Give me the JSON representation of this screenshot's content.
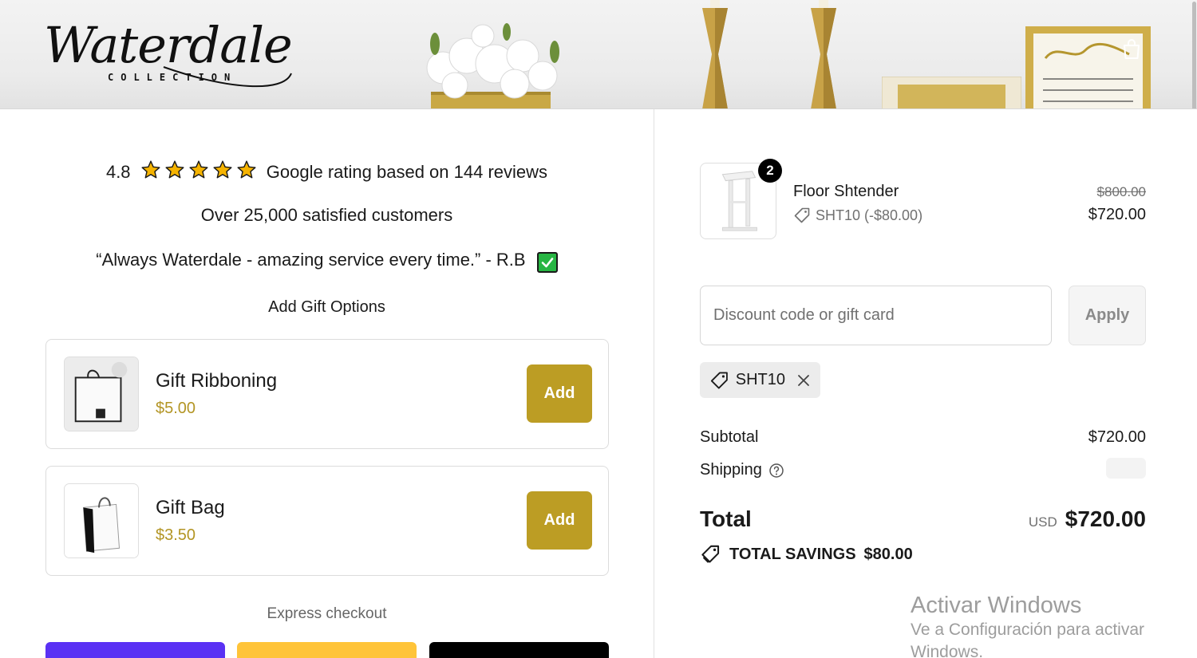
{
  "banner": {
    "logo_text": "Waterdale",
    "logo_subtitle": "COLLECTION"
  },
  "trust": {
    "rating_value": "4.8",
    "rating_text": "Google rating based on 144 reviews",
    "customers_text": "Over 25,000 satisfied customers",
    "quote_text": "“Always Waterdale - amazing service every time.” - R.B"
  },
  "gift_options": {
    "heading": "Add Gift Options",
    "items": [
      {
        "title": "Gift Ribboning",
        "price": "$5.00",
        "button": "Add"
      },
      {
        "title": "Gift Bag",
        "price": "$3.50",
        "button": "Add"
      }
    ]
  },
  "express": {
    "label": "Express checkout",
    "colors": [
      "#5a31f4",
      "#ffc439",
      "#000000"
    ]
  },
  "order": {
    "product": {
      "quantity": "2",
      "name": "Floor Shtender",
      "discount_label": "SHT10 (-$80.00)",
      "price_original": "$800.00",
      "price_final": "$720.00"
    },
    "discount_input": {
      "placeholder": "Discount code or gift card",
      "value": ""
    },
    "apply_button": "Apply",
    "applied_code": "SHT10",
    "subtotal_label": "Subtotal",
    "subtotal_value": "$720.00",
    "shipping_label": "Shipping",
    "total_label": "Total",
    "total_currency": "USD",
    "total_value": "$720.00",
    "savings_label": "TOTAL SAVINGS",
    "savings_value": "$80.00"
  },
  "watermark": {
    "title": "Activar Windows",
    "line1": "Ve a Configuración para activar",
    "line2": "Windows."
  },
  "colors": {
    "accent_gold": "#bc9d24",
    "price_gold": "#b39524",
    "check_green": "#27b543",
    "star_fill": "#f5b301"
  }
}
